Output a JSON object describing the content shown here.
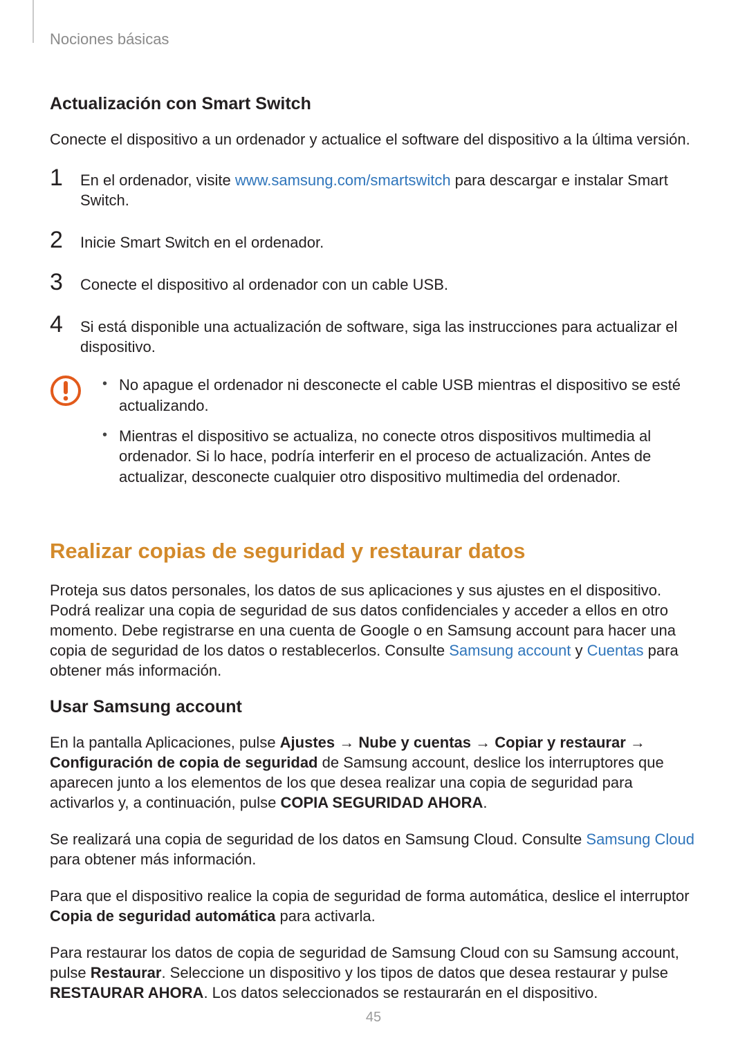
{
  "page": {
    "running_header": "Nociones básicas",
    "number": "45"
  },
  "sect1": {
    "heading": "Actualización con Smart Switch",
    "intro": "Conecte el dispositivo a un ordenador y actualice el software del dispositivo a la última versión.",
    "step1_pre": "En el ordenador, visite ",
    "step1_link": "www.samsung.com/smartswitch",
    "step1_post": " para descargar e instalar Smart Switch.",
    "step2": "Inicie Smart Switch en el ordenador.",
    "step3": "Conecte el dispositivo al ordenador con un cable USB.",
    "step4": "Si está disponible una actualización de software, siga las instrucciones para actualizar el dispositivo.",
    "warn1": "No apague el ordenador ni desconecte el cable USB mientras el dispositivo se esté actualizando.",
    "warn2": "Mientras el dispositivo se actualiza, no conecte otros dispositivos multimedia al ordenador. Si lo hace, podría interferir en el proceso de actualización. Antes de actualizar, desconecte cualquier otro dispositivo multimedia del ordenador."
  },
  "sect2": {
    "title": "Realizar copias de seguridad y restaurar datos",
    "intro_pre": "Proteja sus datos personales, los datos de sus aplicaciones y sus ajustes en el dispositivo. Podrá realizar una copia de seguridad de sus datos confidenciales y acceder a ellos en otro momento. Debe registrarse en una cuenta de Google o en Samsung account para hacer una copia de seguridad de los datos o restablecerlos. Consulte ",
    "intro_link1": "Samsung account",
    "intro_mid": " y ",
    "intro_link2": "Cuentas",
    "intro_post": " para obtener más información."
  },
  "sect3": {
    "heading": "Usar Samsung account",
    "p1_pre": "En la pantalla Aplicaciones, pulse ",
    "p1_b1": "Ajustes",
    "p1_arrow": " → ",
    "p1_b2": "Nube y cuentas",
    "p1_b3": "Copiar y restaurar",
    "p1_b4": "Configuración de copia de seguridad",
    "p1_mid": " de Samsung account, deslice los interruptores que aparecen junto a los elementos de los que desea realizar una copia de seguridad para activarlos y, a continuación, pulse ",
    "p1_b5": "COPIA SEGURIDAD AHORA",
    "p1_end": ".",
    "p2_pre": "Se realizará una copia de seguridad de los datos en Samsung Cloud. Consulte ",
    "p2_link": "Samsung Cloud",
    "p2_post": " para obtener más información.",
    "p3_pre": "Para que el dispositivo realice la copia de seguridad de forma automática, deslice el interruptor ",
    "p3_b1": "Copia de seguridad automática",
    "p3_post": " para activarla.",
    "p4_pre": "Para restaurar los datos de copia de seguridad de Samsung Cloud con su Samsung account, pulse ",
    "p4_b1": "Restaurar",
    "p4_mid": ". Seleccione un dispositivo y los tipos de datos que desea restaurar y pulse ",
    "p4_b2": "RESTAURAR AHORA",
    "p4_post": ". Los datos seleccionados se restaurarán en el dispositivo."
  },
  "nums": {
    "n1": "1",
    "n2": "2",
    "n3": "3",
    "n4": "4"
  }
}
